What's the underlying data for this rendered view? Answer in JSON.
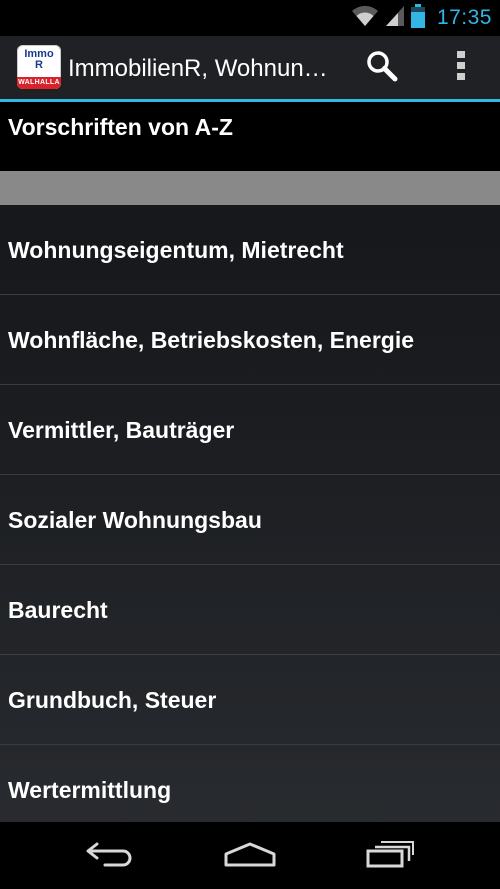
{
  "status_bar": {
    "time": "17:35",
    "icons": [
      "wifi-icon",
      "signal-icon",
      "battery-icon"
    ],
    "time_color": "#33b5e5"
  },
  "action_bar": {
    "app_icon": {
      "line1": "Immo",
      "line2": "R",
      "brand": "WALHALLA"
    },
    "title": "ImmobilienR, Wohnun…",
    "actions": [
      "search-icon",
      "overflow-menu-icon"
    ],
    "accent_color": "#33b5e5"
  },
  "list": {
    "header": "Vorschriften von A-Z",
    "items": [
      {
        "label": "Wohnungseigentum, Mietrecht"
      },
      {
        "label": "Wohnfläche, Betriebskosten, Energie"
      },
      {
        "label": "Vermittler, Bauträger"
      },
      {
        "label": "Sozialer Wohnungsbau"
      },
      {
        "label": "Baurecht"
      },
      {
        "label": "Grundbuch, Steuer"
      },
      {
        "label": "Wertermittlung"
      }
    ]
  },
  "nav_bar": {
    "buttons": [
      "back-icon",
      "home-icon",
      "recent-apps-icon"
    ]
  }
}
